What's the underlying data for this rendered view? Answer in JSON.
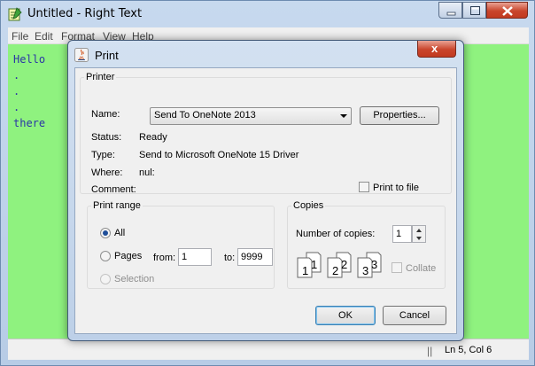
{
  "main_window": {
    "title": "Untitled - Right Text",
    "menu": [
      "File",
      "Edit",
      "Format",
      "View",
      "Help"
    ],
    "editor_lines": [
      "Hello",
      ".",
      ".",
      ".",
      "there"
    ],
    "status_grip": "||",
    "status_position": "Ln 5, Col 6",
    "colors": {
      "editor_background": "#8ff27f",
      "editor_text": "#2b35a6"
    }
  },
  "print_dialog": {
    "title": "Print",
    "close_label": "x",
    "printer": {
      "group_label": "Printer",
      "name_label": "Name:",
      "name_value": "Send To OneNote 2013",
      "properties_label": "Properties...",
      "status_label": "Status:",
      "status_value": "Ready",
      "type_label": "Type:",
      "type_value": "Send to Microsoft OneNote 15 Driver",
      "where_label": "Where:",
      "where_value": "nul:",
      "comment_label": "Comment:",
      "comment_value": "",
      "print_to_file_label": "Print to file",
      "print_to_file_checked": false
    },
    "print_range": {
      "group_label": "Print range",
      "all_label": "All",
      "pages_label": "Pages",
      "from_label": "from:",
      "from_value": "1",
      "to_label": "to:",
      "to_value": "9999",
      "selection_label": "Selection",
      "selected": "All"
    },
    "copies": {
      "group_label": "Copies",
      "number_label": "Number of copies:",
      "number_value": "1",
      "collate_label": "Collate",
      "collate_checked": false,
      "collate_icon_pages": [
        "1",
        "1",
        "2",
        "2",
        "3",
        "3"
      ]
    },
    "ok_label": "OK",
    "cancel_label": "Cancel"
  }
}
